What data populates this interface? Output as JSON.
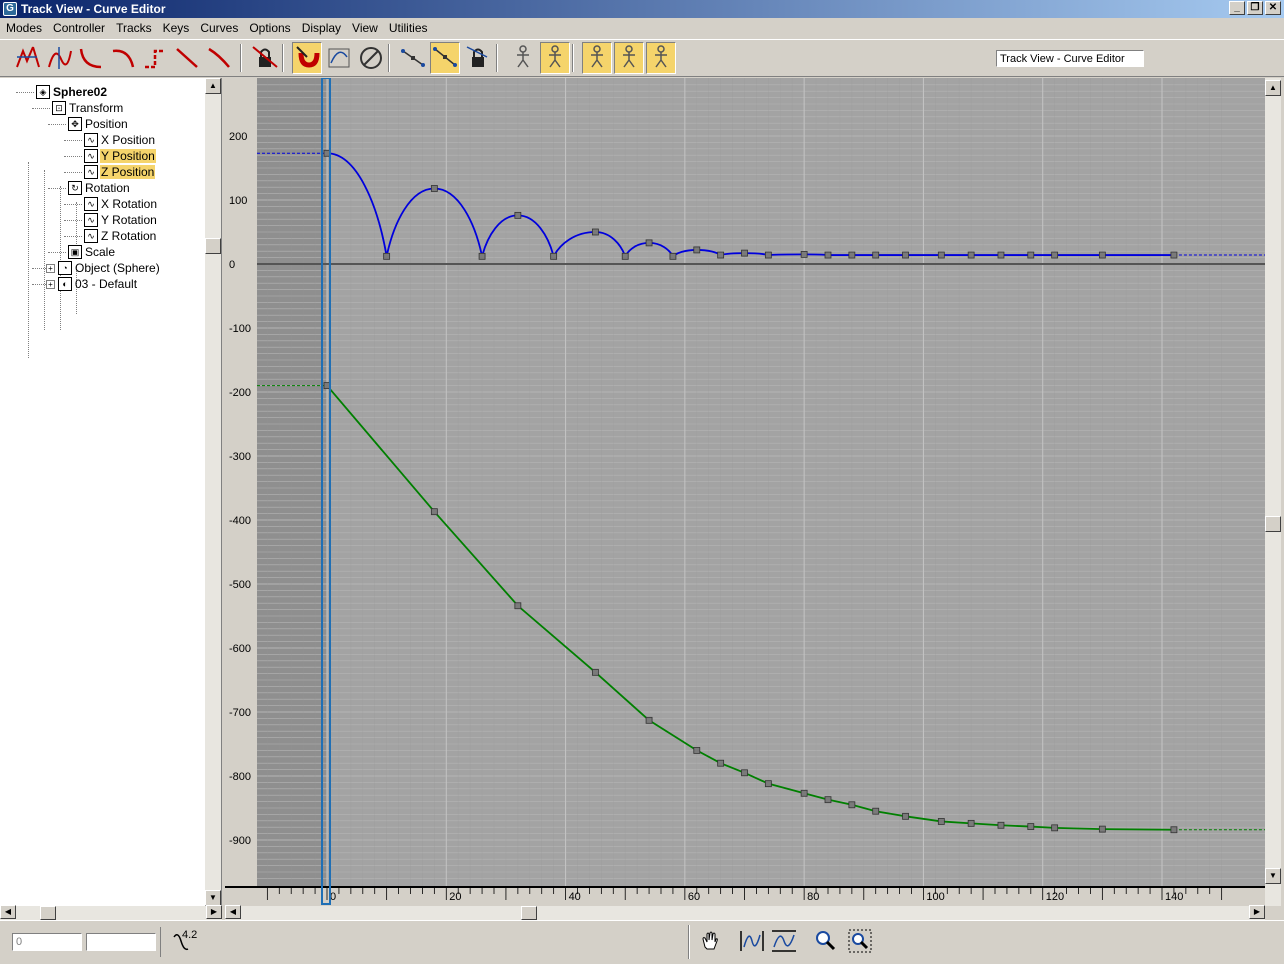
{
  "window": {
    "title": "Track View - Curve Editor",
    "icon": "3ds-max-icon",
    "buttons": [
      "minimize-icon",
      "restore-icon",
      "close-icon"
    ]
  },
  "menu": [
    "Modes",
    "Controller",
    "Tracks",
    "Keys",
    "Curves",
    "Options",
    "Display",
    "View",
    "Utilities"
  ],
  "toolbar": {
    "buttons": [
      {
        "name": "move-keys-icon",
        "active": false
      },
      {
        "name": "scale-keys-icon",
        "active": false
      },
      {
        "name": "curve-tangent-auto-icon",
        "active": false
      },
      {
        "name": "curve-tangent-fast-icon",
        "active": false
      },
      {
        "name": "curve-tangent-step-icon",
        "active": false
      },
      {
        "name": "curve-tangent-linear-icon",
        "active": false
      },
      {
        "name": "curve-tangent-smooth-icon",
        "active": false
      },
      {
        "name": "lock-selection-icon",
        "active": false
      },
      {
        "name": "snap-frames-icon",
        "active": true
      },
      {
        "name": "parameter-curve-out-of-range-icon",
        "active": false
      },
      {
        "name": "filter-icon",
        "active": false
      },
      {
        "name": "show-tangents-icon",
        "active": false
      },
      {
        "name": "show-all-tangents-icon",
        "active": true
      },
      {
        "name": "lock-tangents-icon",
        "active": false
      },
      {
        "name": "biped-icon-1",
        "active": false
      },
      {
        "name": "biped-icon-2",
        "active": true
      },
      {
        "name": "biped-x-icon",
        "active": true
      },
      {
        "name": "biped-y-icon",
        "active": true
      },
      {
        "name": "biped-z-icon",
        "active": true
      }
    ],
    "trackview_name": "Track View - Curve Editor"
  },
  "tree": [
    {
      "label": "Sphere02",
      "depth": 0,
      "icon": "sphere-object-icon",
      "bold": true,
      "selected": false
    },
    {
      "label": "Transform",
      "depth": 1,
      "icon": "transform-icon",
      "selected": false
    },
    {
      "label": "Position",
      "depth": 2,
      "icon": "position-icon",
      "selected": false
    },
    {
      "label": "X Position",
      "depth": 3,
      "icon": "curve-icon",
      "selected": false
    },
    {
      "label": "Y Position",
      "depth": 3,
      "icon": "curve-icon",
      "selected": true
    },
    {
      "label": "Z Position",
      "depth": 3,
      "icon": "curve-icon",
      "selected": true
    },
    {
      "label": "Rotation",
      "depth": 2,
      "icon": "rotation-icon",
      "selected": false
    },
    {
      "label": "X Rotation",
      "depth": 3,
      "icon": "curve-icon",
      "selected": false
    },
    {
      "label": "Y Rotation",
      "depth": 3,
      "icon": "curve-icon",
      "selected": false
    },
    {
      "label": "Z Rotation",
      "depth": 3,
      "icon": "curve-icon",
      "selected": false
    },
    {
      "label": "Scale",
      "depth": 2,
      "icon": "scale-icon",
      "selected": false
    },
    {
      "label": "Object (Sphere)",
      "depth": 1,
      "icon": "object-icon",
      "expander": "+",
      "selected": false
    },
    {
      "label": "03 - Default",
      "depth": 1,
      "icon": "material-icon",
      "expander": "+",
      "selected": false
    }
  ],
  "chart_data": {
    "type": "line",
    "xlim": [
      -12,
      155
    ],
    "ylim": [
      -960,
      285
    ],
    "xticks": [
      "0",
      "20",
      "40",
      "60",
      "80",
      "100",
      "120",
      "140"
    ],
    "yticks": [
      "200",
      "100",
      "0",
      "-100",
      "-200",
      "-300",
      "-400",
      "-500",
      "-600",
      "-700",
      "-800",
      "-900"
    ],
    "xtick_values": [
      0,
      20,
      40,
      60,
      80,
      100,
      120,
      140
    ],
    "ytick_values": [
      200,
      100,
      0,
      -100,
      -200,
      -300,
      -400,
      -500,
      -600,
      -700,
      -800,
      -900
    ],
    "current_frame": 0,
    "grid": true,
    "series": [
      {
        "color": "#0000dd",
        "interpolation": "bounce",
        "x": [
          0,
          10,
          18,
          26,
          32,
          38,
          45,
          50,
          54,
          58,
          62,
          66,
          70,
          74,
          80,
          84,
          88,
          92,
          97,
          103,
          108,
          113,
          118,
          122,
          130,
          142
        ],
        "y": [
          173,
          12,
          118,
          12,
          76,
          12,
          50,
          12,
          33,
          12,
          22,
          14,
          17,
          14,
          15,
          14,
          14,
          14,
          14,
          14,
          14,
          14,
          14,
          14,
          14,
          14
        ]
      },
      {
        "color": "#008000",
        "interpolation": "smooth",
        "x": [
          0,
          18,
          32,
          45,
          54,
          62,
          66,
          70,
          74,
          80,
          84,
          88,
          92,
          97,
          103,
          108,
          113,
          118,
          122,
          130,
          142
        ],
        "y": [
          -190,
          -387,
          -534,
          -638,
          -713,
          -760,
          -780,
          -795,
          -812,
          -827,
          -837,
          -845,
          -855,
          -863,
          -871,
          -874,
          -877,
          -879,
          -881,
          -883,
          -884
        ]
      }
    ]
  },
  "status": {
    "frame_value": "0",
    "value_field": "",
    "tcb_value": "4.2"
  },
  "nav": [
    "pan-hand-icon",
    "zoom-horizontal-extents-icon",
    "zoom-value-extents-icon",
    "zoom-icon",
    "zoom-region-icon"
  ]
}
